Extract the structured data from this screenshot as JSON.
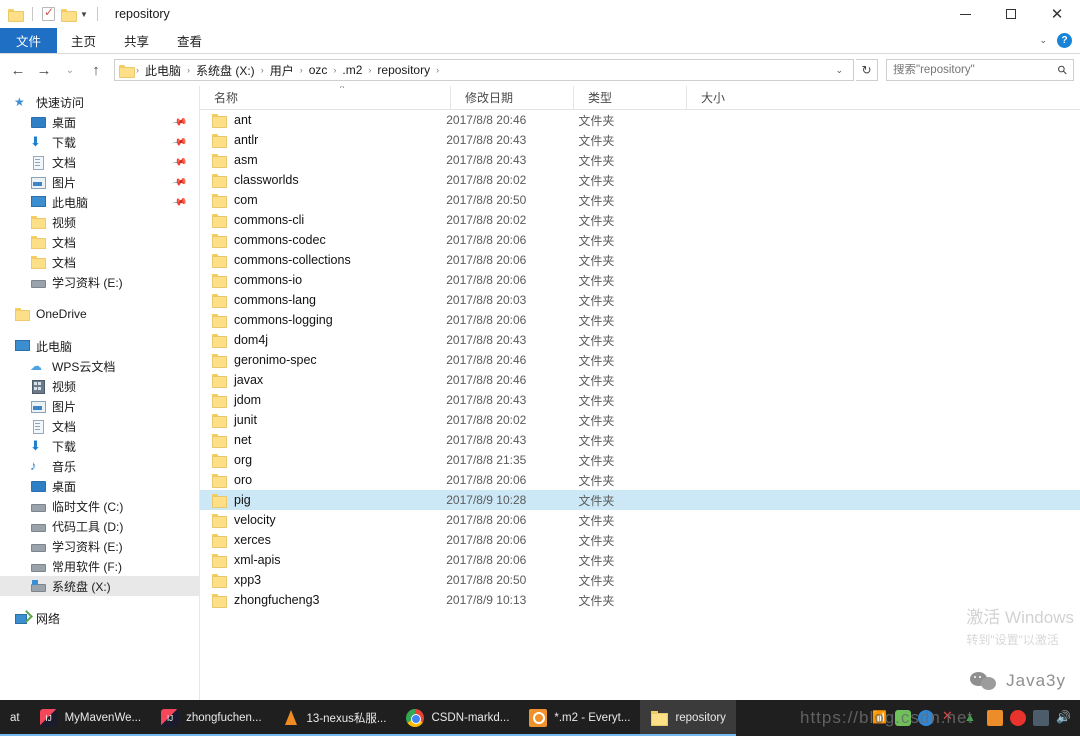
{
  "window": {
    "title": "repository",
    "quick_access": [
      "folder-icon",
      "properties-icon",
      "new-folder-icon",
      "customize-caret"
    ],
    "controls": {
      "minimize": "−",
      "maximize": "□",
      "close": "✕"
    }
  },
  "ribbon": {
    "tabs": [
      {
        "label": "文件",
        "active": true
      },
      {
        "label": "主页",
        "active": false
      },
      {
        "label": "共享",
        "active": false
      },
      {
        "label": "查看",
        "active": false
      }
    ],
    "expand_caret": "⌄",
    "help_label": "?"
  },
  "address": {
    "back": "←",
    "forward": "→",
    "recent": "⌄",
    "up": "↑",
    "breadcrumbs": [
      "此电脑",
      "系统盘 (X:)",
      "用户",
      "ozc",
      ".m2",
      "repository"
    ],
    "separator": "›",
    "dropdown": "⌄",
    "refresh": "↻"
  },
  "search": {
    "placeholder": "搜索\"repository\"",
    "value": "",
    "icon": "search-icon"
  },
  "navpane": {
    "groups": [
      {
        "header": {
          "label": "快速访问",
          "icon": "star-icon"
        },
        "items": [
          {
            "label": "桌面",
            "icon": "desktop-icon",
            "pinned": true
          },
          {
            "label": "下载",
            "icon": "download-icon",
            "pinned": true
          },
          {
            "label": "文档",
            "icon": "document-icon",
            "pinned": true
          },
          {
            "label": "图片",
            "icon": "picture-icon",
            "pinned": true
          },
          {
            "label": "此电脑",
            "icon": "computer-icon",
            "pinned": true
          },
          {
            "label": "视频",
            "icon": "folder-icon",
            "pinned": false
          },
          {
            "label": "文档",
            "icon": "folder-icon",
            "pinned": false
          },
          {
            "label": "文档",
            "icon": "folder-icon",
            "pinned": false
          },
          {
            "label": "学习资料 (E:)",
            "icon": "drive-icon",
            "pinned": false
          }
        ]
      },
      {
        "header": {
          "label": "OneDrive",
          "icon": "folder-icon"
        },
        "items": []
      },
      {
        "header": {
          "label": "此电脑",
          "icon": "computer-icon"
        },
        "items": [
          {
            "label": "WPS云文档",
            "icon": "cloud-icon",
            "selected": false
          },
          {
            "label": "视频",
            "icon": "video-icon",
            "selected": false
          },
          {
            "label": "图片",
            "icon": "picture-icon",
            "selected": false
          },
          {
            "label": "文档",
            "icon": "document-icon",
            "selected": false
          },
          {
            "label": "下载",
            "icon": "download-icon",
            "selected": false
          },
          {
            "label": "音乐",
            "icon": "music-icon",
            "selected": false
          },
          {
            "label": "桌面",
            "icon": "desktop-icon",
            "selected": false
          },
          {
            "label": "临时文件 (C:)",
            "icon": "drive-icon",
            "selected": false
          },
          {
            "label": "代码工具 (D:)",
            "icon": "drive-icon",
            "selected": false
          },
          {
            "label": "学习资料 (E:)",
            "icon": "drive-icon",
            "selected": false
          },
          {
            "label": "常用软件 (F:)",
            "icon": "drive-icon",
            "selected": false
          },
          {
            "label": "系统盘 (X:)",
            "icon": "system-drive-icon",
            "selected": true
          }
        ]
      },
      {
        "header": {
          "label": "网络",
          "icon": "network-icon"
        },
        "items": []
      }
    ]
  },
  "filelist": {
    "columns": [
      {
        "label": "名称",
        "sorted": "asc",
        "sort_glyph": "^"
      },
      {
        "label": "修改日期",
        "sorted": ""
      },
      {
        "label": "类型",
        "sorted": ""
      },
      {
        "label": "大小",
        "sorted": ""
      }
    ],
    "rows": [
      {
        "name": "ant",
        "date": "2017/8/8 20:46",
        "type": "文件夹",
        "size": "",
        "selected": false
      },
      {
        "name": "antlr",
        "date": "2017/8/8 20:43",
        "type": "文件夹",
        "size": "",
        "selected": false
      },
      {
        "name": "asm",
        "date": "2017/8/8 20:43",
        "type": "文件夹",
        "size": "",
        "selected": false
      },
      {
        "name": "classworlds",
        "date": "2017/8/8 20:02",
        "type": "文件夹",
        "size": "",
        "selected": false
      },
      {
        "name": "com",
        "date": "2017/8/8 20:50",
        "type": "文件夹",
        "size": "",
        "selected": false
      },
      {
        "name": "commons-cli",
        "date": "2017/8/8 20:02",
        "type": "文件夹",
        "size": "",
        "selected": false
      },
      {
        "name": "commons-codec",
        "date": "2017/8/8 20:06",
        "type": "文件夹",
        "size": "",
        "selected": false
      },
      {
        "name": "commons-collections",
        "date": "2017/8/8 20:06",
        "type": "文件夹",
        "size": "",
        "selected": false
      },
      {
        "name": "commons-io",
        "date": "2017/8/8 20:06",
        "type": "文件夹",
        "size": "",
        "selected": false
      },
      {
        "name": "commons-lang",
        "date": "2017/8/8 20:03",
        "type": "文件夹",
        "size": "",
        "selected": false
      },
      {
        "name": "commons-logging",
        "date": "2017/8/8 20:06",
        "type": "文件夹",
        "size": "",
        "selected": false
      },
      {
        "name": "dom4j",
        "date": "2017/8/8 20:43",
        "type": "文件夹",
        "size": "",
        "selected": false
      },
      {
        "name": "geronimo-spec",
        "date": "2017/8/8 20:46",
        "type": "文件夹",
        "size": "",
        "selected": false
      },
      {
        "name": "javax",
        "date": "2017/8/8 20:46",
        "type": "文件夹",
        "size": "",
        "selected": false
      },
      {
        "name": "jdom",
        "date": "2017/8/8 20:43",
        "type": "文件夹",
        "size": "",
        "selected": false
      },
      {
        "name": "junit",
        "date": "2017/8/8 20:02",
        "type": "文件夹",
        "size": "",
        "selected": false
      },
      {
        "name": "net",
        "date": "2017/8/8 20:43",
        "type": "文件夹",
        "size": "",
        "selected": false
      },
      {
        "name": "org",
        "date": "2017/8/8 21:35",
        "type": "文件夹",
        "size": "",
        "selected": false
      },
      {
        "name": "oro",
        "date": "2017/8/8 20:06",
        "type": "文件夹",
        "size": "",
        "selected": false
      },
      {
        "name": "pig",
        "date": "2017/8/9 10:28",
        "type": "文件夹",
        "size": "",
        "selected": true
      },
      {
        "name": "velocity",
        "date": "2017/8/8 20:06",
        "type": "文件夹",
        "size": "",
        "selected": false
      },
      {
        "name": "xerces",
        "date": "2017/8/8 20:06",
        "type": "文件夹",
        "size": "",
        "selected": false
      },
      {
        "name": "xml-apis",
        "date": "2017/8/8 20:06",
        "type": "文件夹",
        "size": "",
        "selected": false
      },
      {
        "name": "xpp3",
        "date": "2017/8/8 20:50",
        "type": "文件夹",
        "size": "",
        "selected": false
      },
      {
        "name": "zhongfucheng3",
        "date": "2017/8/9 10:13",
        "type": "文件夹",
        "size": "",
        "selected": false
      }
    ]
  },
  "watermarks": {
    "activate_title": "激活 Windows",
    "activate_sub": "转到\"设置\"以激活",
    "brand": "Java3y",
    "url": "https://blog.csdn.net"
  },
  "taskbar": {
    "items": [
      {
        "label": "at",
        "icon": "cropped-icon",
        "state": "open"
      },
      {
        "label": "MyMavenWe...",
        "icon": "intellij-icon",
        "state": "open"
      },
      {
        "label": "zhongfuchen...",
        "icon": "intellij-icon",
        "state": "open"
      },
      {
        "label": "13-nexus私服...",
        "icon": "vlc-icon",
        "state": "open"
      },
      {
        "label": "CSDN-markd...",
        "icon": "chrome-icon",
        "state": "open"
      },
      {
        "label": "*.m2 - Everyt...",
        "icon": "everything-icon",
        "state": "open"
      },
      {
        "label": "repository",
        "icon": "folder-icon",
        "state": "active"
      }
    ],
    "tray": [
      "wifi-icon",
      "green-app-icon",
      "blue-globe-icon",
      "red-x-icon",
      "nat-icon",
      "orange-app-icon",
      "music-app-icon",
      "camera-icon",
      "volume-icon"
    ]
  }
}
